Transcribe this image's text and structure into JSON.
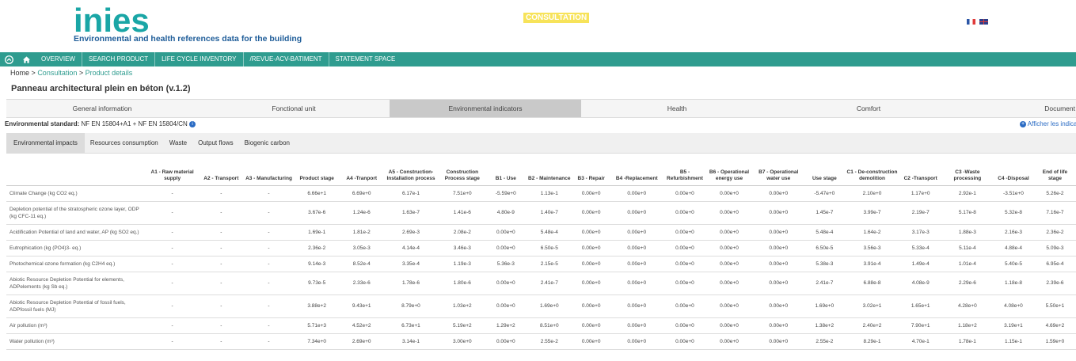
{
  "header": {
    "logo_text": "inies",
    "tagline": "Environmental and health references data for the building",
    "badge": "CONSULTATION"
  },
  "nav": {
    "items": [
      "OVERVIEW",
      "SEARCH PRODUCT",
      "LIFE CYCLE INVENTORY",
      "/REVUE-ACV-BATIMENT",
      "STATEMENT SPACE"
    ]
  },
  "breadcrumb": {
    "home": "Home",
    "sep1": ">",
    "consultation": "Consultation",
    "sep2": ">",
    "current": "Product details"
  },
  "page_title": "Panneau architectural plein en béton (v.1.2)",
  "main_tabs": [
    "General information",
    "Fonctional unit",
    "Environmental indicators",
    "Health",
    "Comfort",
    "Document"
  ],
  "main_tab_active": 2,
  "standard": {
    "label": "Environmental standard:",
    "value": "NF EN 15804+A1 + NF EN 15804/CN"
  },
  "show_indicators": "Afficher les indicate",
  "sub_tabs": [
    "Environmental impacts",
    "Resources consumption",
    "Waste",
    "Output flows",
    "Biogenic carbon"
  ],
  "sub_tab_active": 0,
  "table": {
    "headers": [
      "",
      "A1 - Raw material supply",
      "A2 - Transport",
      "A3 - Manufacturing",
      "Product stage",
      "A4 -Tranport",
      "A5 - Construction-Installation process",
      "Construction Process stage",
      "B1 - Use",
      "B2 - Maintenance",
      "B3 - Repair",
      "B4 -Replacement",
      "B5 - Refurbishment",
      "B6 - Operational energy use",
      "B7 - Operational water use",
      "Use stage",
      "C1 - De-construction demolition",
      "C2 -Transport",
      "C3 -Waste processing",
      "C4 -Disposal",
      "End of life stage"
    ],
    "rows": [
      {
        "label": "Climate Change (kg CO2 eq.)",
        "cells": [
          "-",
          "-",
          "-",
          "6.66e+1",
          "6.69e+0",
          "6.17e-1",
          "7.51e+0",
          "-5.59e+0",
          "1.13e-1",
          "0.00e+0",
          "0.00e+0",
          "0.00e+0",
          "0.00e+0",
          "0.00e+0",
          "-5.47e+0",
          "2.10e+0",
          "1.17e+0",
          "2.92e-1",
          "-3.51e+0",
          "5.26e-2"
        ]
      },
      {
        "label": "Depletion potential of the stratospheric ozone layer, ODP (kg CFC-11 eq.)",
        "cells": [
          "-",
          "-",
          "-",
          "3.67e-6",
          "1.24e-6",
          "1.63e-7",
          "1.41e-6",
          "4.80e-9",
          "1.40e-7",
          "0.00e+0",
          "0.00e+0",
          "0.00e+0",
          "0.00e+0",
          "0.00e+0",
          "1.45e-7",
          "3.99e-7",
          "2.19e-7",
          "5.17e-8",
          "5.32e-8",
          "7.16e-7"
        ]
      },
      {
        "label": "Acidification Potential of land and water, AP (kg SO2 eq.)",
        "cells": [
          "-",
          "-",
          "-",
          "1.69e-1",
          "1.81e-2",
          "2.69e-3",
          "2.08e-2",
          "0.00e+0",
          "5.48e-4",
          "0.00e+0",
          "0.00e+0",
          "0.00e+0",
          "0.00e+0",
          "0.00e+0",
          "5.48e-4",
          "1.64e-2",
          "3.17e-3",
          "1.88e-3",
          "2.16e-3",
          "2.36e-2"
        ]
      },
      {
        "label": "Eutrophication (kg (PO4)3- eq.)",
        "cells": [
          "-",
          "-",
          "-",
          "2.36e-2",
          "3.05e-3",
          "4.14e-4",
          "3.46e-3",
          "0.00e+0",
          "6.50e-5",
          "0.00e+0",
          "0.00e+0",
          "0.00e+0",
          "0.00e+0",
          "0.00e+0",
          "6.50e-5",
          "3.56e-3",
          "5.33e-4",
          "5.11e-4",
          "4.88e-4",
          "5.09e-3"
        ]
      },
      {
        "label": "Photochemical ozone formation (kg C2H4 eq.)",
        "cells": [
          "-",
          "-",
          "-",
          "9.14e-3",
          "8.52e-4",
          "3.35e-4",
          "1.19e-3",
          "5.36e-3",
          "2.15e-5",
          "0.00e+0",
          "0.00e+0",
          "0.00e+0",
          "0.00e+0",
          "0.00e+0",
          "5.38e-3",
          "3.91e-4",
          "1.49e-4",
          "1.01e-4",
          "5.40e-5",
          "6.95e-4"
        ]
      },
      {
        "label": "Abiotic Resource Depletion Potential for elements, ADPelements (kg Sb eq.)",
        "cells": [
          "-",
          "-",
          "-",
          "9.73e-5",
          "2.33e-6",
          "1.78e-6",
          "1.80e-6",
          "0.00e+0",
          "2.41e-7",
          "0.00e+0",
          "0.00e+0",
          "0.00e+0",
          "0.00e+0",
          "0.00e+0",
          "2.41e-7",
          "6.88e-8",
          "4.08e-9",
          "2.29e-6",
          "1.18e-8",
          "2.39e-6"
        ]
      },
      {
        "label": "Abiotic Resource Depletion Potential of fossil fuels, ADPfossil fuels (MJ)",
        "cells": [
          "-",
          "-",
          "-",
          "3.88e+2",
          "9.43e+1",
          "8.79e+0",
          "1.03e+2",
          "0.00e+0",
          "1.69e+0",
          "0.00e+0",
          "0.00e+0",
          "0.00e+0",
          "0.00e+0",
          "0.00e+0",
          "1.69e+0",
          "3.02e+1",
          "1.65e+1",
          "4.28e+0",
          "4.08e+0",
          "5.50e+1"
        ]
      },
      {
        "label": "Air pollution (m³)",
        "cells": [
          "-",
          "-",
          "-",
          "5.71e+3",
          "4.52e+2",
          "6.73e+1",
          "5.19e+2",
          "1.29e+2",
          "8.51e+0",
          "0.00e+0",
          "0.00e+0",
          "0.00e+0",
          "0.00e+0",
          "0.00e+0",
          "1.38e+2",
          "2.40e+2",
          "7.90e+1",
          "1.18e+2",
          "3.19e+1",
          "4.69e+2"
        ]
      },
      {
        "label": "Water pollution (m³)",
        "cells": [
          "-",
          "-",
          "-",
          "7.34e+0",
          "2.69e+0",
          "3.14e-1",
          "3.00e+0",
          "0.00e+0",
          "2.55e-2",
          "0.00e+0",
          "0.00e+0",
          "0.00e+0",
          "0.00e+0",
          "0.00e+0",
          "2.55e-2",
          "8.29e-1",
          "4.70e-1",
          "1.78e-1",
          "1.15e-1",
          "1.59e+0"
        ]
      }
    ]
  },
  "colors": {
    "brand": "#1aa6a6",
    "nav_bg": "#2f9c8f",
    "badge_bg": "#f7e35a",
    "active_tab_bg": "#c9c9c9",
    "link": "#2b6cc4"
  },
  "icons": {
    "nav_toggle": "chevron-circle-icon",
    "home": "home-icon",
    "info": "info-icon",
    "plus": "plus-circle-icon"
  }
}
